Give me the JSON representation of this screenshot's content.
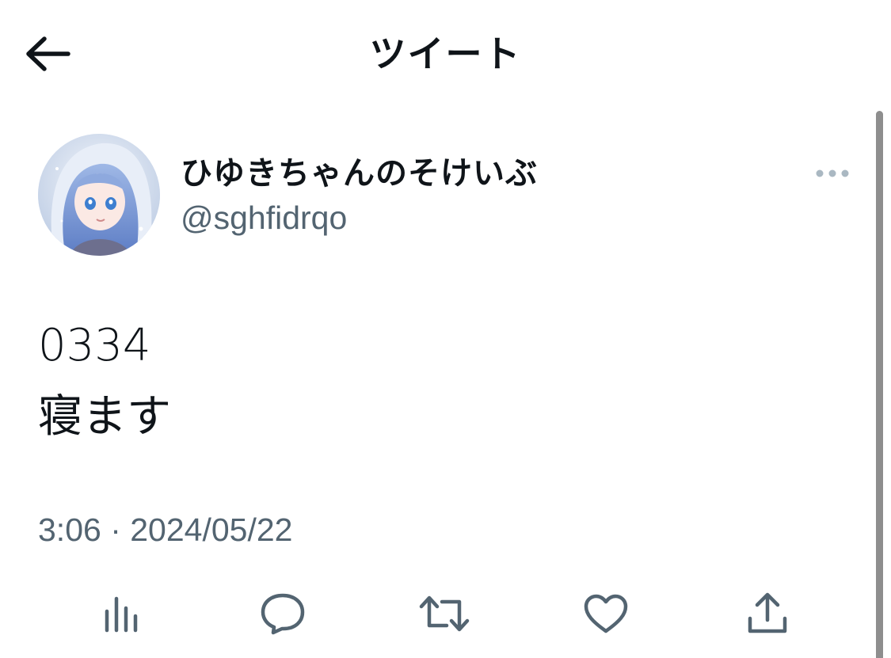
{
  "header": {
    "title": "ツイート",
    "back_icon": "arrow-left-icon"
  },
  "tweet": {
    "author": {
      "display_name": "ひゆきちゃんのそけいぶ",
      "handle": "@sghfidrqo",
      "avatar_icon": "avatar-anime-girl"
    },
    "text": "0334\n寝ます",
    "timestamp": "3:06 · 2024/05/22",
    "more_icon": "more-dots-icon"
  },
  "actions": [
    {
      "name": "views",
      "icon": "bar-chart-icon"
    },
    {
      "name": "reply",
      "icon": "chat-bubble-icon"
    },
    {
      "name": "retweet",
      "icon": "retweet-icon"
    },
    {
      "name": "like",
      "icon": "heart-icon"
    },
    {
      "name": "share",
      "icon": "share-upload-icon"
    }
  ],
  "colors": {
    "text_primary": "#0f1419",
    "text_secondary": "#536471",
    "icon_gray": "#536471",
    "scrollbar": "#8e8e8e",
    "background": "#ffffff"
  }
}
